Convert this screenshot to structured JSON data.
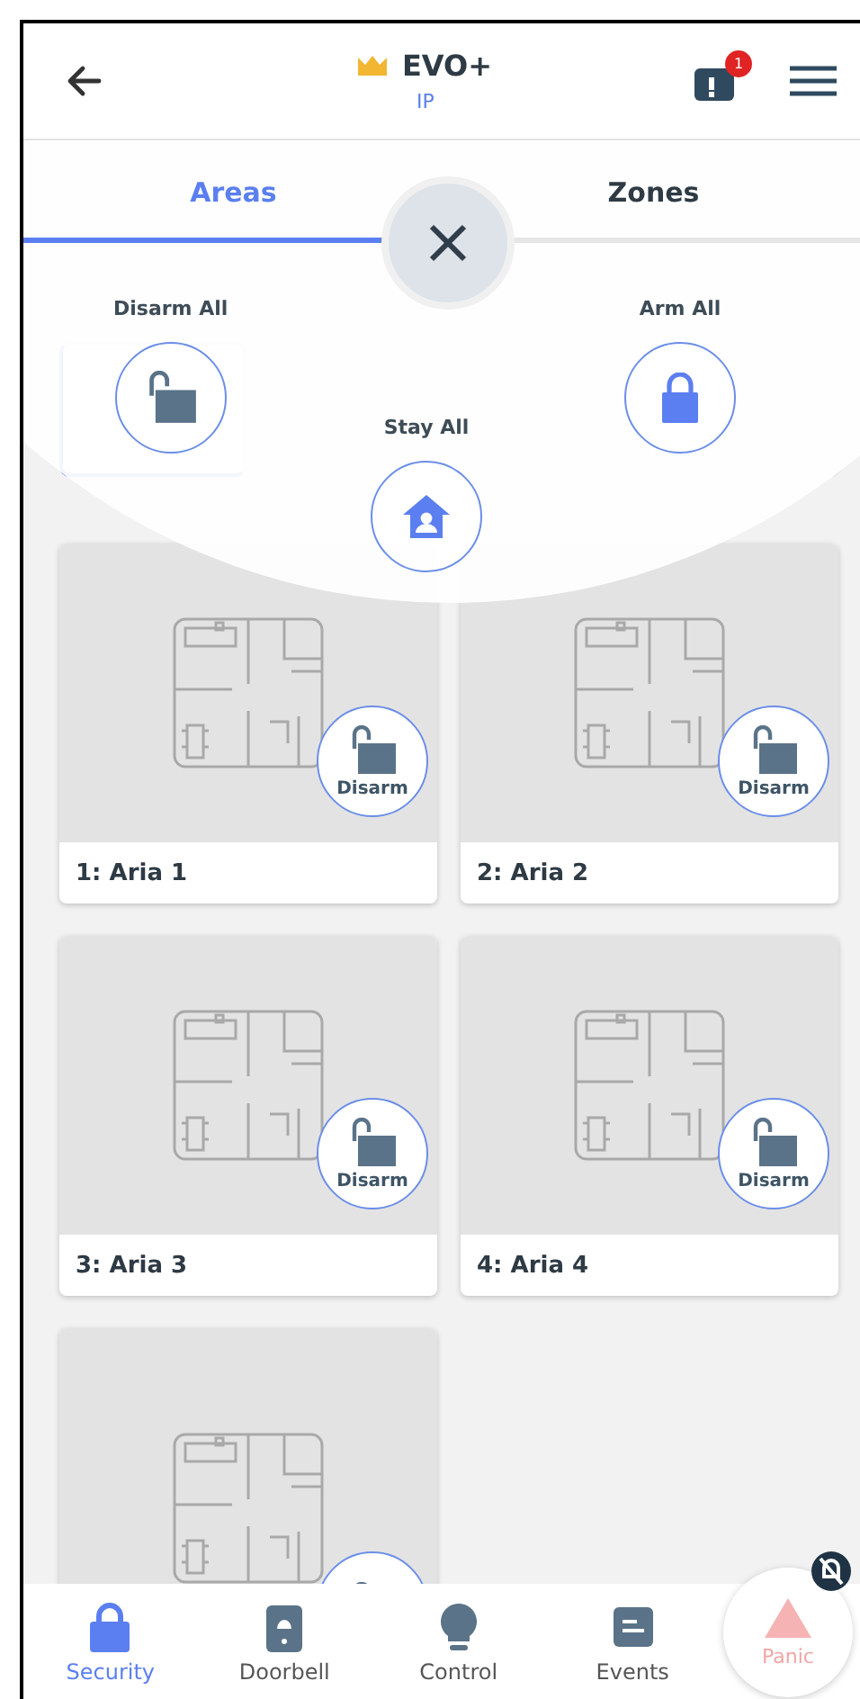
{
  "header": {
    "title": "EVO+",
    "subtitle": "IP",
    "notification_count": "1"
  },
  "tabs": [
    {
      "label": "Areas",
      "selected": true
    },
    {
      "label": "Zones",
      "selected": false
    }
  ],
  "quick_actions": [
    {
      "label": "Disarm All",
      "kind": "disarm"
    },
    {
      "label": "Stay All",
      "kind": "stay"
    },
    {
      "label": "Arm All",
      "kind": "arm"
    }
  ],
  "areas": [
    {
      "name": "1: Aria 1",
      "action": "Disarm"
    },
    {
      "name": "2: Aria 2",
      "action": "Disarm"
    },
    {
      "name": "3: Aria 3",
      "action": "Disarm"
    },
    {
      "name": "4: Aria 4",
      "action": "Disarm"
    },
    {
      "kind": "cut_off"
    }
  ],
  "nav": [
    {
      "label": "Security",
      "selected": true
    },
    {
      "label": "Doorbell",
      "selected": false
    },
    {
      "label": "Control",
      "selected": false
    },
    {
      "label": "Events",
      "selected": false
    }
  ],
  "panic": {
    "label": "Panic"
  }
}
